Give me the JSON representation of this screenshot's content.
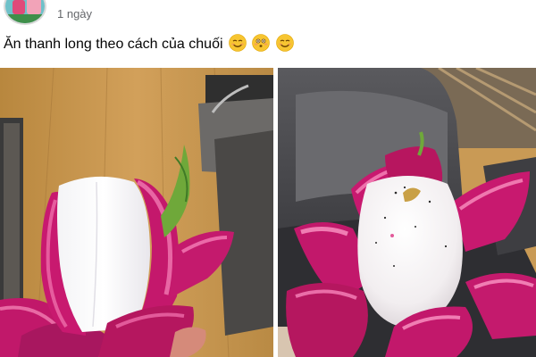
{
  "post": {
    "timestamp": "1 ngày",
    "text": "Ăn thanh long theo cách của chuối",
    "emojis": [
      "smiling-face-icon",
      "flushed-face-icon",
      "smiling-face-icon"
    ]
  },
  "photos": [
    {
      "subject": "peeled dragon fruit with white flesh inside pink petals"
    },
    {
      "subject": "dragon fruit peeled like a banana on a grey sofa"
    }
  ]
}
